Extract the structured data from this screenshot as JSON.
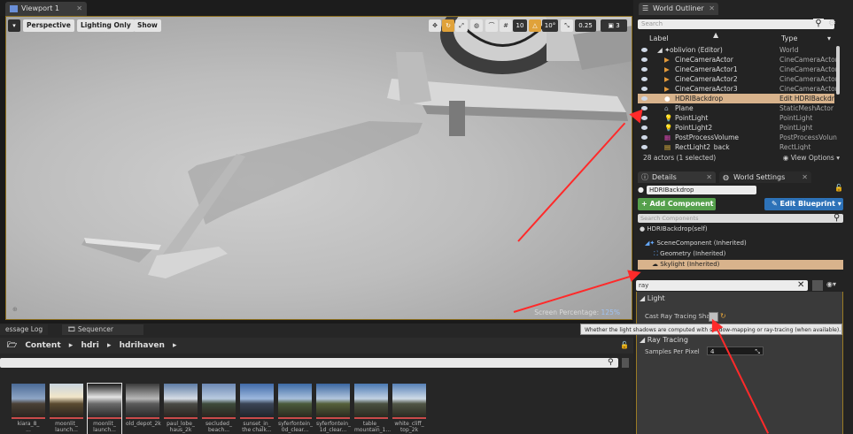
{
  "viewport": {
    "tab_label": "Viewport 1",
    "perspective": "Perspective",
    "lighting": "Lighting Only",
    "show": "Show",
    "grid_snap": "10",
    "rot_snap": "10°",
    "scale_snap": "0.25",
    "cam_speed": "3",
    "screen_pct_label": "Screen Percentage",
    "screen_pct_value": "125%"
  },
  "bottom": {
    "tabs": [
      "essage Log",
      "Sequencer"
    ],
    "breadcrumb": [
      "Content",
      "hdri",
      "hdrihaven"
    ],
    "assets": [
      {
        "l1": "kiara_8_",
        "l2": "..."
      },
      {
        "l1": "moonlit_",
        "l2": "launch..."
      },
      {
        "l1": "moonlit_",
        "l2": "launch..."
      },
      {
        "l1": "old_depot_2k",
        "l2": ""
      },
      {
        "l1": "paul_lobe_",
        "l2": "haus_2k"
      },
      {
        "l1": "secluded_",
        "l2": "beach..."
      },
      {
        "l1": "sunset_in_",
        "l2": "the chalk..."
      },
      {
        "l1": "syferfontein_",
        "l2": "0d_clear..."
      },
      {
        "l1": "syferfontein_",
        "l2": "1d_clear..."
      },
      {
        "l1": "table_",
        "l2": "mountain_1..."
      },
      {
        "l1": "white_cliff_",
        "l2": "top_2k"
      }
    ]
  },
  "outliner": {
    "tab_label": "World Outliner",
    "search_placeholder": "Search",
    "col_label": "Label",
    "col_type": "Type",
    "rows": [
      {
        "label": "oblivion (Editor)",
        "type": "World"
      },
      {
        "label": "CineCameraActor",
        "type": "CineCameraActor"
      },
      {
        "label": "CineCameraActor1",
        "type": "CineCameraActor"
      },
      {
        "label": "CineCameraActor2",
        "type": "CineCameraActor"
      },
      {
        "label": "CineCameraActor3",
        "type": "CineCameraActor"
      },
      {
        "label": "HDRIBackdrop",
        "type": "Edit HDRIBackdr"
      },
      {
        "label": "Plane",
        "type": "StaticMeshActor"
      },
      {
        "label": "PointLight",
        "type": "PointLight"
      },
      {
        "label": "PointLight2",
        "type": "PointLight"
      },
      {
        "label": "PostProcessVolume",
        "type": "PostProcessVolun"
      },
      {
        "label": "RectLight2_back",
        "type": "RectLight"
      }
    ],
    "footer": "28 actors (1 selected)",
    "view_options": "View Options"
  },
  "details": {
    "tab_details": "Details",
    "tab_world": "World Settings",
    "actor_name": "HDRIBackdrop",
    "add_component": "+ Add Component",
    "edit_blueprint": "Edit Blueprint",
    "search_components": "Search Components",
    "components": [
      "HDRIBackdrop(self)",
      "SceneComponent (Inherited)",
      "Geometry (Inherited)",
      "Skylight (Inherited)"
    ],
    "filter_value": "ray",
    "section_light": "Light",
    "prop_cast": "Cast Ray Tracing Shad",
    "tooltip": "Whether the light shadows are computed with shadow-mapping or ray-tracing (when available).",
    "section_rt": "Ray Tracing",
    "prop_samples": "Samples Per Pixel",
    "samples_value": "4"
  }
}
